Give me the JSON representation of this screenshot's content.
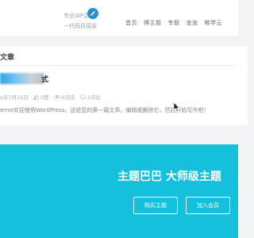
{
  "header": {
    "logo_line1": "专业WP主题",
    "logo_line2": "一代码风接装",
    "nav": [
      "首页",
      "博主题",
      "专题",
      "宠宠",
      "畅学云"
    ]
  },
  "card": {
    "section_title": "文章",
    "post_title_suffix": "式",
    "meta": {
      "date": "e年7月31日",
      "likes": "0赞",
      "views": "0浏览",
      "comments": "1评论"
    },
    "excerpt": "error欢迎使用WordPress。这是您的第一篇文章。编辑或删除它，然后开始写作吧！"
  },
  "banner": {
    "title": "主题巴巴 大师级主题",
    "buy_button": "购买主题",
    "join_button": "加入会员"
  },
  "colors": {
    "banner": "#14c0dc",
    "accent": "#2b8fcf"
  }
}
